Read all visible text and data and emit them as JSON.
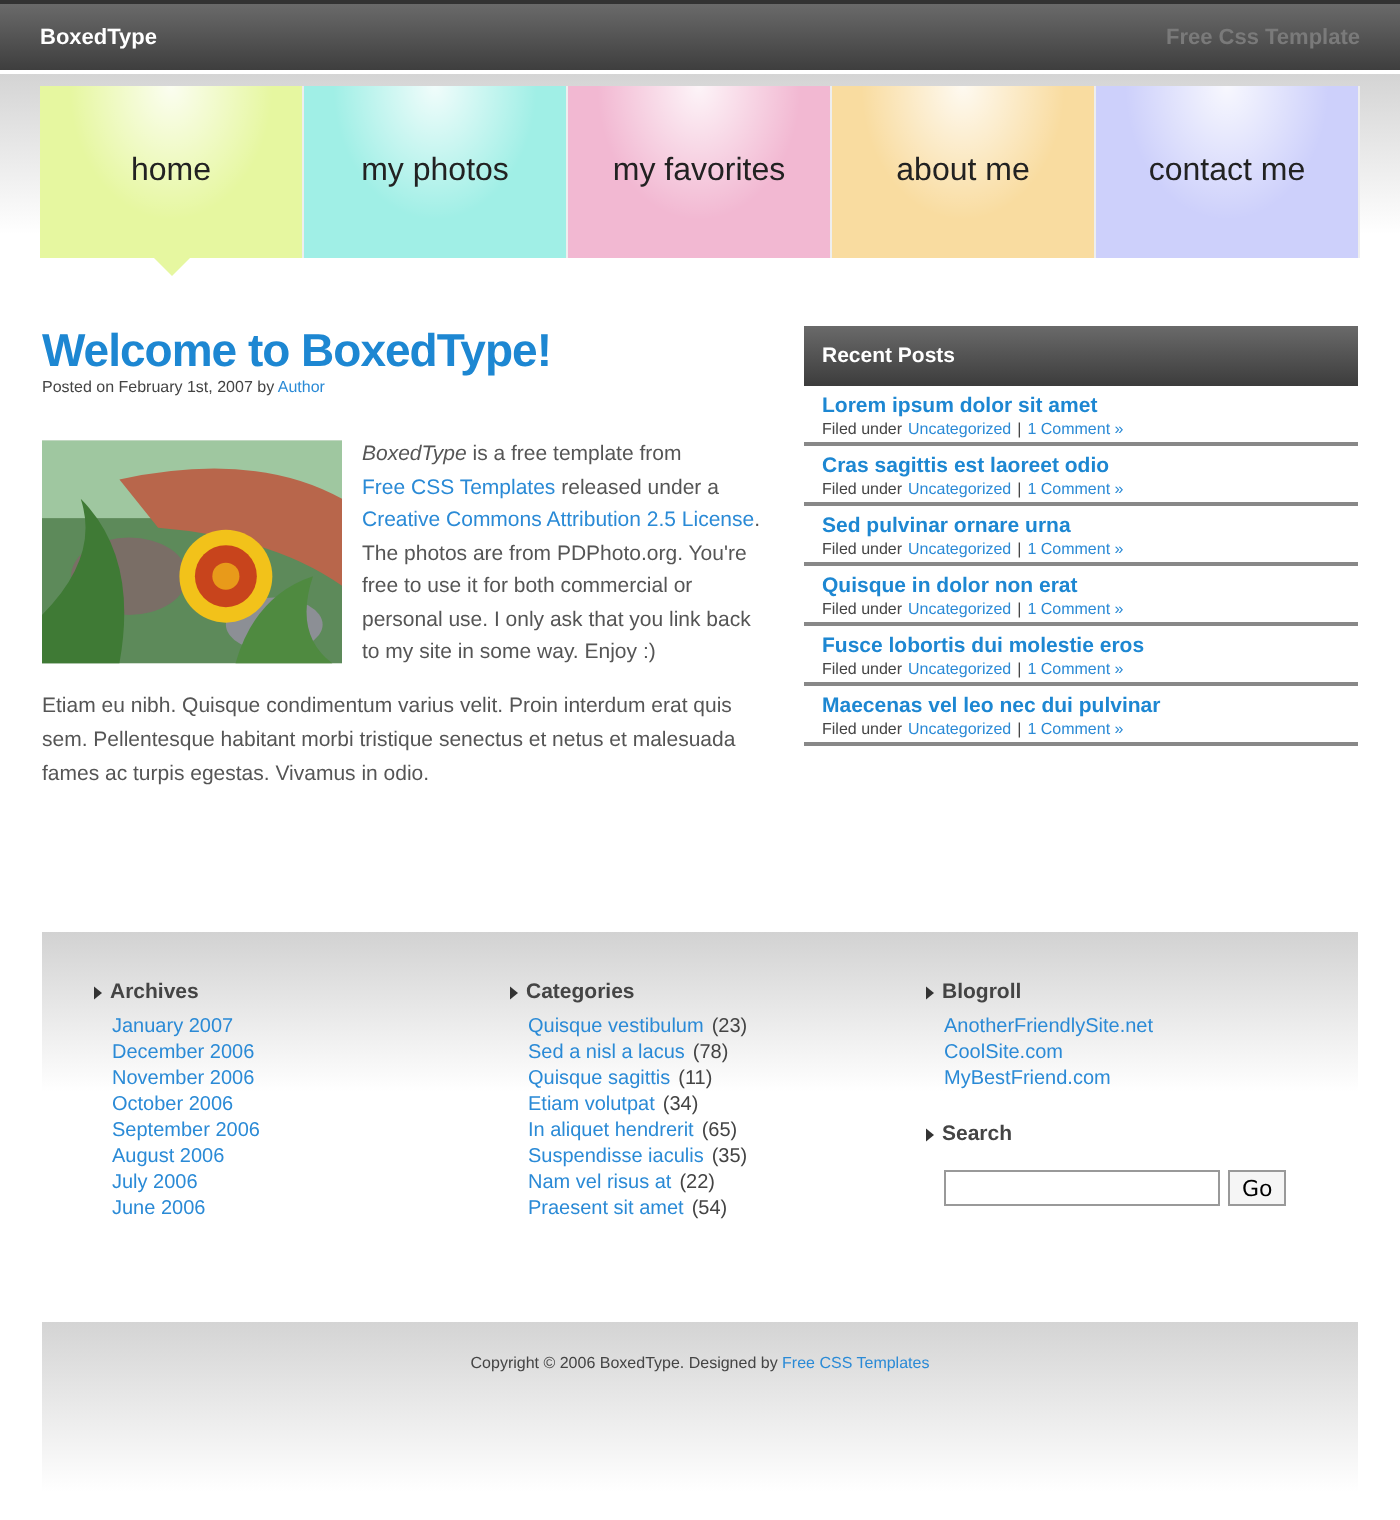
{
  "header": {
    "logo": "BoxedType",
    "tagline": "Free Css Template"
  },
  "nav": [
    {
      "label": "home",
      "selected": true,
      "color": "#e6f7a0"
    },
    {
      "label": "my photos",
      "selected": false,
      "color": "#a0efe6"
    },
    {
      "label": "my favorites",
      "selected": false,
      "color": "#f2b8d2"
    },
    {
      "label": "about me",
      "selected": false,
      "color": "#f9dca0"
    },
    {
      "label": "contact me",
      "selected": false,
      "color": "#cdd0fb"
    }
  ],
  "post": {
    "title": "Welcome to BoxedType!",
    "meta": [
      {
        "kind": "text",
        "text": "Posted on February 1st, 2007 by "
      },
      {
        "kind": "link",
        "text": "Author"
      }
    ],
    "intro": [
      {
        "kind": "text",
        "text": "*BoxedType* is a free template from "
      },
      {
        "kind": "link",
        "text": "Free CSS Templates"
      },
      {
        "kind": "text",
        "text": " released under a "
      },
      {
        "kind": "link",
        "text": "Creative Commons Attribution 2.5 License"
      },
      {
        "kind": "text",
        "text": ". The photos are from PDPhoto.org. You're free to use it for both commercial or personal use. I only ask that you link back to my site in some way. Enjoy :)"
      }
    ],
    "body": "Etiam eu nibh. Quisque condimentum varius velit. Proin interdum erat quis sem. Pellentesque habitant morbi tristique senectus et netus et malesuada fames ac turpis egestas. Vivamus in odio."
  },
  "recent_posts": {
    "title": "Recent Posts",
    "items": [
      {
        "title": "Lorem ipsum dolor sit amet",
        "filed": "Filed under",
        "category": "Uncategorized",
        "sep": "|",
        "comments": "1 Comment »"
      },
      {
        "title": "Cras sagittis est laoreet odio",
        "filed": "Filed under",
        "category": "Uncategorized",
        "sep": "|",
        "comments": "1 Comment »"
      },
      {
        "title": "Sed pulvinar ornare urna",
        "filed": "Filed under",
        "category": "Uncategorized",
        "sep": "|",
        "comments": "1 Comment »"
      },
      {
        "title": "Quisque in dolor non erat",
        "filed": "Filed under",
        "category": "Uncategorized",
        "sep": "|",
        "comments": "1 Comment »"
      },
      {
        "title": "Fusce lobortis dui molestie eros",
        "filed": "Filed under",
        "category": "Uncategorized",
        "sep": "|",
        "comments": "1 Comment »"
      },
      {
        "title": "Maecenas vel leo nec dui pulvinar",
        "filed": "Filed under",
        "category": "Uncategorized",
        "sep": "|",
        "comments": "1 Comment »"
      }
    ]
  },
  "archives": {
    "title": "Archives",
    "items": [
      "January 2007",
      "December 2006",
      "November 2006",
      "October 2006",
      "September 2006",
      "August 2006",
      "July 2006",
      "June 2006"
    ]
  },
  "categories": {
    "title": "Categories",
    "items": [
      {
        "name": "Quisque vestibulum",
        "count": "(23)"
      },
      {
        "name": "Sed a nisl a lacus",
        "count": "(78)"
      },
      {
        "name": "Quisque sagittis",
        "count": "(11)"
      },
      {
        "name": "Etiam volutpat",
        "count": "(34)"
      },
      {
        "name": "In aliquet hendrerit",
        "count": "(65)"
      },
      {
        "name": "Suspendisse iaculis",
        "count": "(35)"
      },
      {
        "name": "Nam vel risus at",
        "count": "(22)"
      },
      {
        "name": "Praesent sit amet",
        "count": "(54)"
      }
    ]
  },
  "blogroll": {
    "title": "Blogroll",
    "items": [
      "AnotherFriendlySite.net",
      "CoolSite.com",
      "MyBestFriend.com"
    ]
  },
  "search": {
    "title": "Search",
    "button": "Go"
  },
  "footer": {
    "text": "Copyright © 2006 BoxedType. Designed by ",
    "link": "Free CSS Templates"
  }
}
